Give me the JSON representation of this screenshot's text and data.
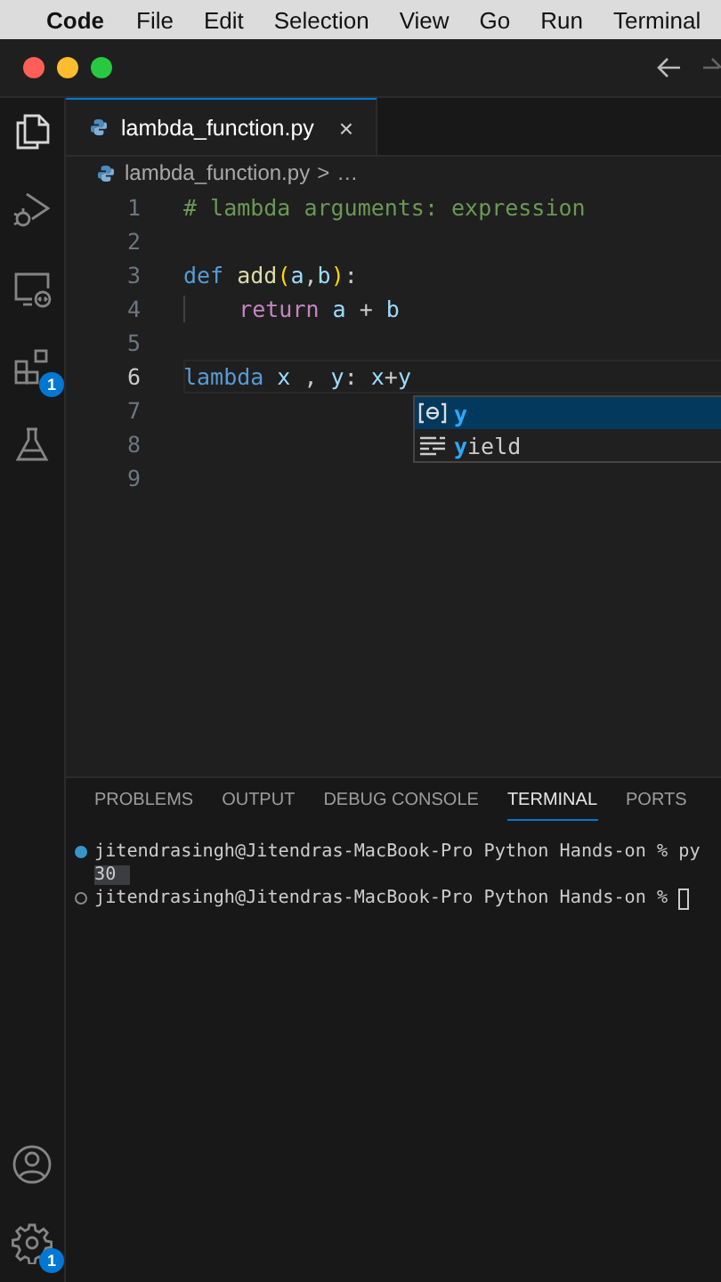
{
  "menu_bar": {
    "app": "Code",
    "items": [
      "File",
      "Edit",
      "Selection",
      "View",
      "Go",
      "Run",
      "Terminal"
    ]
  },
  "activity_bar": {
    "top": [
      {
        "kind": "files",
        "selected": true
      },
      {
        "kind": "debug",
        "selected": false
      },
      {
        "kind": "remote",
        "selected": false
      },
      {
        "kind": "extensions",
        "selected": false,
        "badge": "1"
      },
      {
        "kind": "flask",
        "selected": false
      }
    ],
    "bottom": [
      {
        "kind": "account",
        "selected": false
      },
      {
        "kind": "gear",
        "selected": false,
        "badge": "1"
      }
    ]
  },
  "tabs": [
    {
      "label": "lambda_function.py",
      "selected": true,
      "close": "×"
    }
  ],
  "breadcrumb": {
    "file": "lambda_function.py",
    "separator": ">",
    "more": "…"
  },
  "editor": {
    "lines": [
      {
        "number": "1",
        "active": false,
        "tokens": [
          {
            "kind": "comment",
            "text": "# lambda arguments: expression"
          }
        ]
      },
      {
        "number": "2",
        "active": false
      },
      {
        "number": "3",
        "active": false,
        "tokens": [
          {
            "kind": "keyword",
            "text": "def"
          },
          {
            "kind": "function",
            "text": " add"
          },
          {
            "kind": "bracket",
            "text": "("
          },
          {
            "kind": "param",
            "text": "a"
          },
          {
            "kind": "plain",
            "text": ","
          },
          {
            "kind": "param",
            "text": "b"
          },
          {
            "kind": "bracket",
            "text": ")"
          },
          {
            "kind": "plain",
            "text": ":"
          }
        ]
      },
      {
        "number": "4",
        "active": false,
        "tokens": [
          {
            "kind": "indent"
          },
          {
            "kind": "control",
            "text": "return"
          },
          {
            "kind": "param",
            "text": " a"
          },
          {
            "kind": "plain",
            "text": " + "
          },
          {
            "kind": "param",
            "text": "b"
          }
        ]
      },
      {
        "number": "5",
        "active": false
      },
      {
        "number": "6",
        "active": true,
        "tokens": [
          {
            "kind": "keyword",
            "text": "lambda"
          },
          {
            "kind": "param",
            "text": " x"
          },
          {
            "kind": "plain",
            "text": " , "
          },
          {
            "kind": "param",
            "text": "y"
          },
          {
            "kind": "plain",
            "text": ": "
          },
          {
            "kind": "param",
            "text": "x"
          },
          {
            "kind": "plain",
            "text": "+"
          },
          {
            "kind": "param",
            "text": "y"
          }
        ]
      },
      {
        "number": "7",
        "active": false
      },
      {
        "number": "8",
        "active": false
      },
      {
        "number": "9",
        "active": false
      }
    ]
  },
  "suggestions": [
    {
      "kind": "variable",
      "match": "y",
      "selected": true
    },
    {
      "kind": "keyword",
      "match": "y",
      "rest": "ield",
      "selected": false
    }
  ],
  "panel": {
    "tabs": [
      {
        "label": "PROBLEMS",
        "selected": false
      },
      {
        "label": "OUTPUT",
        "selected": false
      },
      {
        "label": "DEBUG CONSOLE",
        "selected": false
      },
      {
        "label": "TERMINAL",
        "selected": true
      },
      {
        "label": "PORTS",
        "selected": false
      }
    ],
    "terminal": [
      {
        "kind": "prompt",
        "done": true,
        "text": "jitendrasingh@Jitendras-MacBook-Pro Python Hands-on % py"
      },
      {
        "kind": "output",
        "text": "30"
      },
      {
        "kind": "prompt",
        "done": false,
        "text": "jitendrasingh@Jitendras-MacBook-Pro Python Hands-on %",
        "cursor": true
      }
    ]
  }
}
